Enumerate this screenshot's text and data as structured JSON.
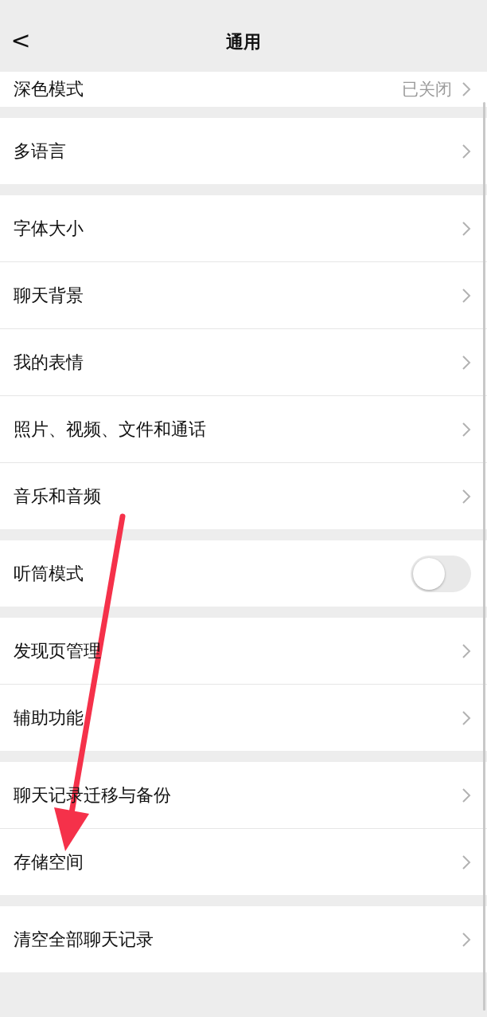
{
  "header": {
    "back": "<",
    "title": "通用"
  },
  "groups": [
    {
      "rows": [
        {
          "kind": "link",
          "label": "深色模式",
          "value": "已关闭"
        }
      ]
    },
    {
      "rows": [
        {
          "kind": "link",
          "label": "多语言"
        }
      ]
    },
    {
      "rows": [
        {
          "kind": "link",
          "label": "字体大小"
        },
        {
          "kind": "link",
          "label": "聊天背景"
        },
        {
          "kind": "link",
          "label": "我的表情"
        },
        {
          "kind": "link",
          "label": "照片、视频、文件和通话"
        },
        {
          "kind": "link",
          "label": "音乐和音频"
        }
      ]
    },
    {
      "rows": [
        {
          "kind": "toggle",
          "label": "听筒模式",
          "on": false
        }
      ]
    },
    {
      "rows": [
        {
          "kind": "link",
          "label": "发现页管理"
        },
        {
          "kind": "link",
          "label": "辅助功能"
        }
      ]
    },
    {
      "rows": [
        {
          "kind": "link",
          "label": "聊天记录迁移与备份"
        },
        {
          "kind": "link",
          "label": "存储空间"
        }
      ]
    },
    {
      "rows": [
        {
          "kind": "link",
          "label": "清空全部聊天记录"
        }
      ]
    }
  ]
}
